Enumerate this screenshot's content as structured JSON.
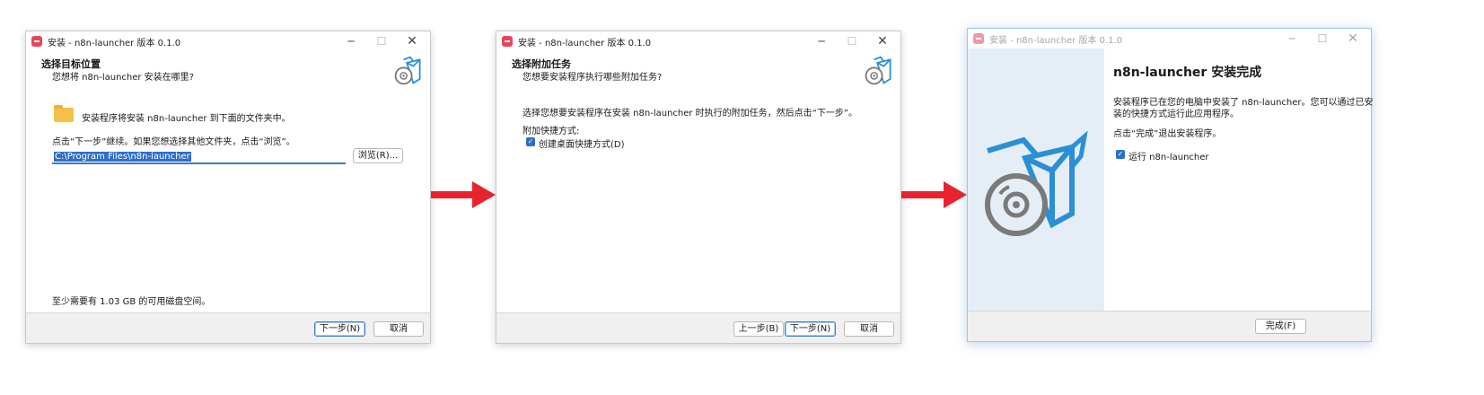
{
  "windows": [
    {
      "title": "安装 - n8n-launcher 版本 0.1.0",
      "header_title": "选择目标位置",
      "header_subtitle": "您想将 n8n-launcher 安装在哪里?",
      "folder_text": "安装程序将安装 n8n-launcher 到下面的文件夹中。",
      "instruction": "点击“下一步”继续。如果您想选择其他文件夹，点击“浏览”。",
      "path_value": "C:\\Program Files\\n8n-launcher",
      "browse_label": "浏览(R)...",
      "disk_space": "至少需要有 1.03 GB 的可用磁盘空间。",
      "next_label": "下一步(N)",
      "cancel_label": "取消"
    },
    {
      "title": "安装 - n8n-launcher 版本 0.1.0",
      "header_title": "选择附加任务",
      "header_subtitle": "您想要安装程序执行哪些附加任务?",
      "description": "选择您想要安装程序在安装 n8n-launcher 时执行的附加任务，然后点击“下一步”。",
      "group_label": "附加快捷方式:",
      "checkbox_label": "创建桌面快捷方式(D)",
      "checkbox_checked": true,
      "back_label": "上一步(B)",
      "next_label": "下一步(N)",
      "cancel_label": "取消"
    },
    {
      "title": "安装 - n8n-launcher 版本 0.1.0",
      "finish_title": "n8n-launcher 安装完成",
      "finish_text_1": "安装程序已在您的电脑中安装了 n8n-launcher。您可以通过已安",
      "finish_text_2": "装的快捷方式运行此应用程序。",
      "exit_text": "点击“完成”退出安装程序。",
      "run_label": "运行 n8n-launcher",
      "run_checked": true,
      "finish_label": "完成(F)"
    }
  ],
  "colors": {
    "arrow": "#e8232f",
    "accent": "#2f6fc6",
    "box_icon": "#2b8fd6",
    "side_panel": "#e5eef6"
  },
  "icons": {
    "app": "n8n-app-icon",
    "installer": "installer-box-disc-icon",
    "folder": "folder-icon"
  }
}
